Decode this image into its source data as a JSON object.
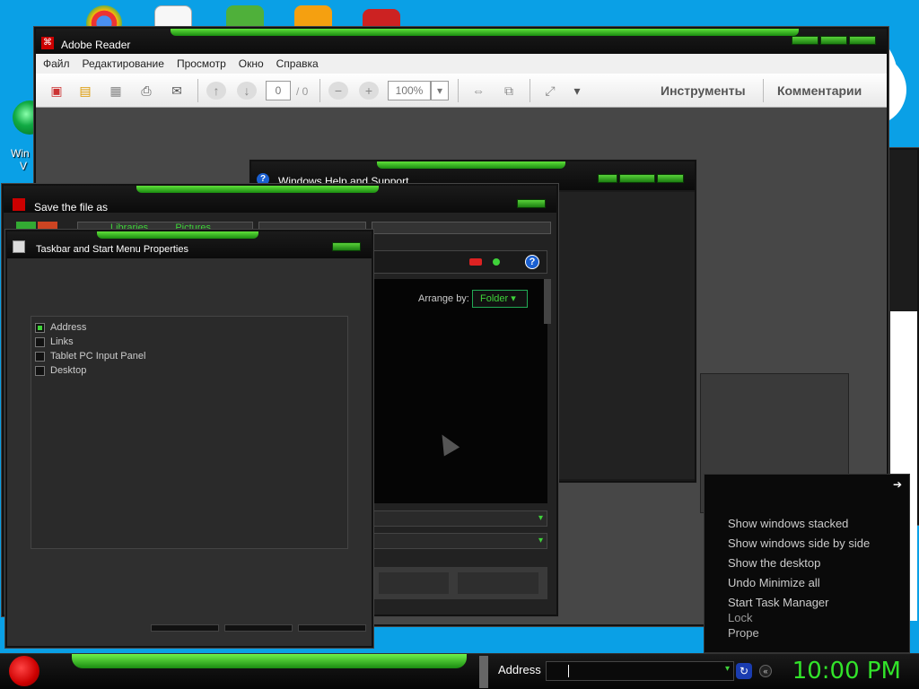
{
  "desktop": {
    "icon_label_partial_1": "Win",
    "icon_label_partial_2": "V"
  },
  "adobe_reader": {
    "title": "Adobe Reader",
    "menu": [
      "Файл",
      "Редактирование",
      "Просмотр",
      "Окно",
      "Справка"
    ],
    "page_current": "0",
    "page_total": "/ 0",
    "zoom": "100%",
    "tools_label": "Инструменты",
    "comments_label": "Комментарии"
  },
  "help_window": {
    "title": "Windows Help and Support"
  },
  "save_dialog": {
    "title": "Save the file as",
    "breadcrumb": [
      "Libraries",
      "Pictures"
    ],
    "arrange_by_label": "Arrange by:",
    "arrange_by_value": "Folder"
  },
  "taskbar_props": {
    "title": "Taskbar and Start Menu Properties",
    "toolbars": [
      {
        "label": "Address",
        "checked": true
      },
      {
        "label": "Links",
        "checked": false
      },
      {
        "label": "Tablet PC Input Panel",
        "checked": false
      },
      {
        "label": "Desktop",
        "checked": false
      }
    ]
  },
  "context_menu": {
    "items": [
      "Show windows stacked",
      "Show windows side by side",
      "Show the desktop",
      "Undo Minimize all",
      "Start Task Manager"
    ],
    "partial_items": [
      "Lock",
      "Prope"
    ]
  },
  "taskbar": {
    "address_label": "Address",
    "address_value": "",
    "clock": "10:00 PM"
  },
  "colors": {
    "accent_green": "#3fd23a",
    "desktop_blue": "#0aa0e6",
    "clock_green": "#32e32a"
  }
}
